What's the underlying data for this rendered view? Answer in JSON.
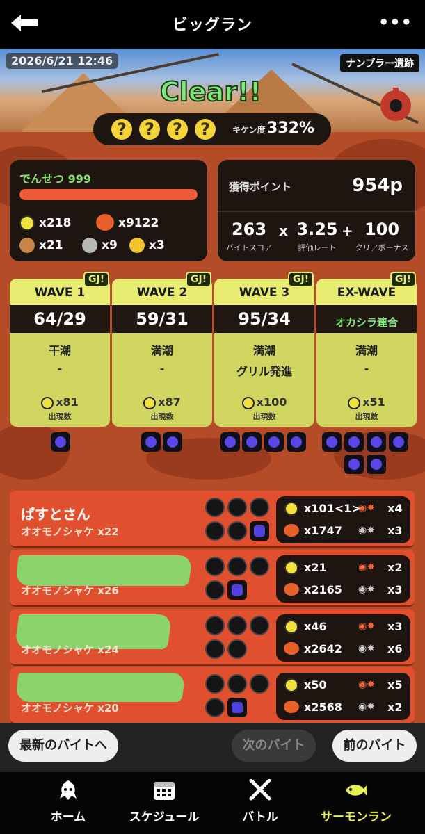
{
  "header": {
    "title": "ビッグラン"
  },
  "banner": {
    "datetime": "2026/6/21 12:46",
    "stage": "ナンプラー遺跡",
    "result": "Clear!!"
  },
  "hazard": {
    "golden_eggs": [
      "?",
      "?",
      "?",
      "?"
    ],
    "label": "キケン度",
    "value": "332%"
  },
  "player_summary": {
    "title": "でんせつ 999",
    "resources": {
      "golden_eggs": "x218",
      "power_eggs": "x9122",
      "bronze_scales": "x21",
      "silver_scales": "x9",
      "gold_scales": "x3"
    }
  },
  "points": {
    "label": "獲得ポイント",
    "value": "954p",
    "job_score": "263",
    "job_score_label": "バイトスコア",
    "multiply": "x",
    "pay_grade": "3.25",
    "pay_grade_label": "評価レート",
    "plus": "+",
    "clear_bonus": "100",
    "clear_bonus_label": "クリアボーナス"
  },
  "waves": [
    {
      "name": "WAVE 1",
      "badge": "GJ!",
      "score": "64/29",
      "tide": "干潮",
      "event": "-",
      "eggs": "x81",
      "eggs_label": "出現数",
      "boss_count": 1
    },
    {
      "name": "WAVE 2",
      "badge": "GJ!",
      "score": "59/31",
      "tide": "満潮",
      "event": "-",
      "eggs": "x87",
      "eggs_label": "出現数",
      "boss_count": 2
    },
    {
      "name": "WAVE 3",
      "badge": "GJ!",
      "score": "95/34",
      "tide": "満潮",
      "event": "グリル発進",
      "eggs": "x100",
      "eggs_label": "出現数",
      "boss_count": 4
    },
    {
      "name": "EX-WAVE",
      "badge": "GJ!",
      "score": "オカシラ連合",
      "tide": "満潮",
      "event": "-",
      "eggs": "x51",
      "eggs_label": "出現数",
      "boss_count": 6
    }
  ],
  "players": [
    {
      "name": "ぱすとさん",
      "title": "オオモノシャケ x22",
      "golden": "x101<1>",
      "power": "x1747",
      "rescues": "x4",
      "deaths": "x3",
      "hidden": false
    },
    {
      "name": "",
      "title": "オオモノシャケ x26",
      "golden": "x21",
      "power": "x2165",
      "rescues": "x2",
      "deaths": "x3",
      "hidden": true
    },
    {
      "name": "",
      "title": "オオモノシャケ x24",
      "golden": "x46",
      "power": "x2642",
      "rescues": "x3",
      "deaths": "x6",
      "hidden": true
    },
    {
      "name": "",
      "title": "オオモノシャケ x20",
      "golden": "x50",
      "power": "x2568",
      "rescues": "x5",
      "deaths": "x2",
      "hidden": true
    }
  ],
  "nav_buttons": {
    "latest": "最新のバイトへ",
    "next": "次のバイト",
    "prev": "前のバイト"
  },
  "tabs": [
    {
      "label": "ホーム",
      "icon": "squid-icon"
    },
    {
      "label": "スケジュール",
      "icon": "calendar-icon"
    },
    {
      "label": "バトル",
      "icon": "crossed-weapons-icon"
    },
    {
      "label": "サーモンラン",
      "icon": "salmon-icon",
      "active": true
    }
  ],
  "colors": {
    "accent_green": "#8ee06f",
    "wave_yellow": "#cfd55f",
    "player_orange": "#e04f2e",
    "active_tab": "#e8ef52"
  }
}
